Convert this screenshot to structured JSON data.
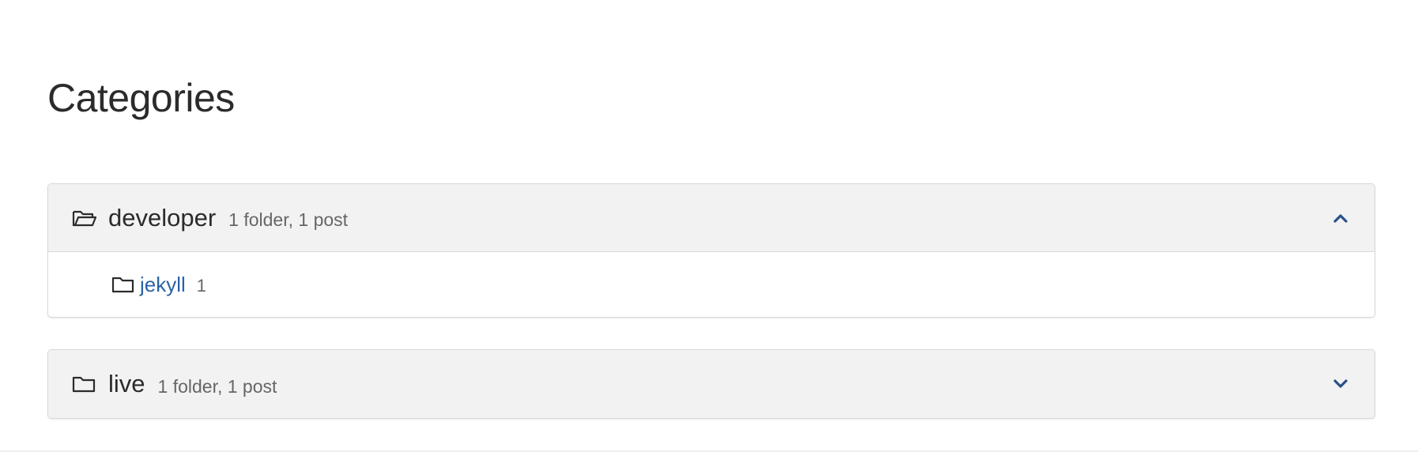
{
  "page": {
    "title": "Categories"
  },
  "categories": [
    {
      "name": "developer",
      "meta": "1 folder, 1 post",
      "expanded": true,
      "icon": "folder-open-icon",
      "toggle_icon": "chevron-up-icon",
      "subcategories": [
        {
          "name": "jekyll",
          "count": "1",
          "icon": "folder-icon"
        }
      ]
    },
    {
      "name": "live",
      "meta": "1 folder, 1 post",
      "expanded": false,
      "icon": "folder-icon",
      "toggle_icon": "chevron-down-icon",
      "subcategories": []
    }
  ],
  "colors": {
    "link": "#2a62a6",
    "chevron": "#2a4f8a",
    "header_bg": "#f2f2f2",
    "border": "#d8d8d8",
    "text": "#2b2b2b",
    "muted": "#666666"
  }
}
